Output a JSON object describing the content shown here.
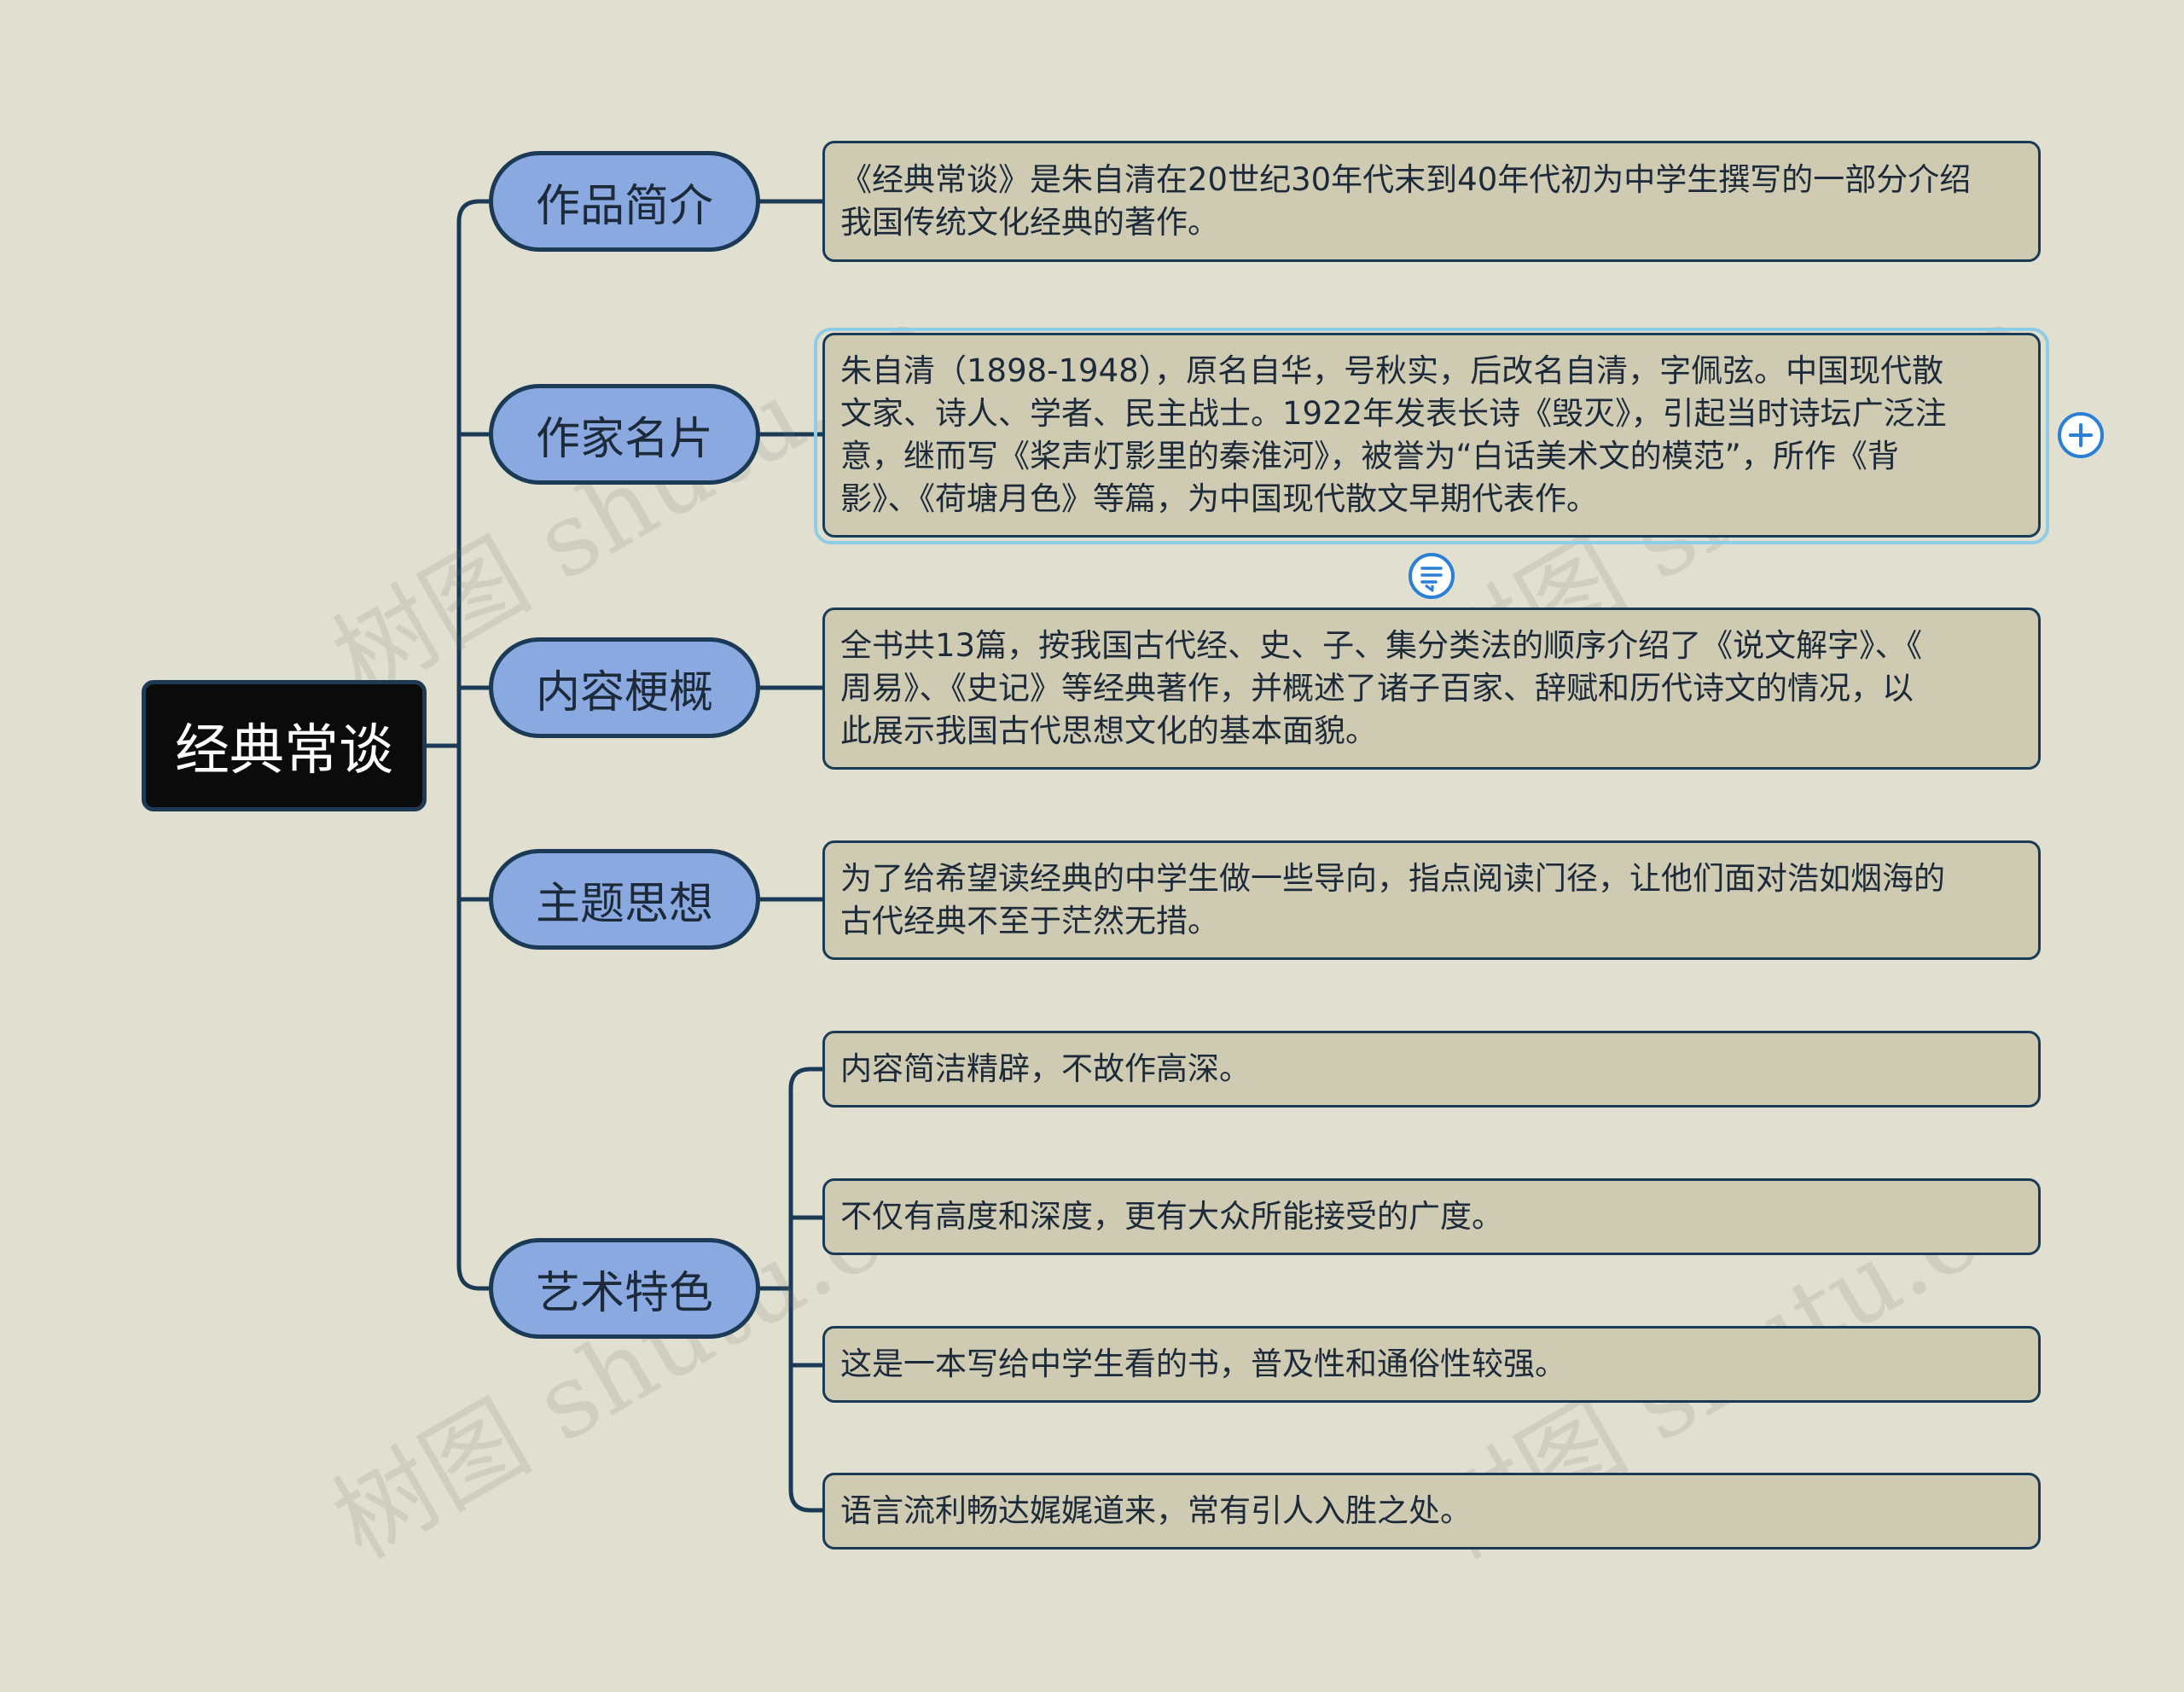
{
  "watermark_text": "树图 shutu.cn",
  "root": {
    "label": "经典常谈"
  },
  "branches": [
    {
      "label": "作品简介",
      "leaves": [
        {
          "lines": [
            "《经典常谈》是朱自清在20世纪30年代末到40年代初为中学生撰写的一部分介绍",
            "我国传统文化经典的著作。"
          ]
        }
      ]
    },
    {
      "label": "作家名片",
      "leaves": [
        {
          "lines": [
            "朱自清（1898-1948），原名自华，号秋实，后改名自清，字佩弦。中国现代散",
            "文家、诗人、学者、民主战士。1922年发表长诗《毁灭》，引起当时诗坛广泛注",
            "意，继而写《桨声灯影里的秦淮河》，被誉为“白话美术文的模范”，所作《背",
            "影》、《荷塘月色》等篇，为中国现代散文早期代表作。"
          ]
        }
      ]
    },
    {
      "label": "内容梗概",
      "leaves": [
        {
          "lines": [
            "全书共13篇，按我国古代经、史、子、集分类法的顺序介绍了《说文解字》、《",
            "周易》、《史记》等经典著作，并概述了诸子百家、辞赋和历代诗文的情况，以",
            "此展示我国古代思想文化的基本面貌。"
          ]
        }
      ]
    },
    {
      "label": "主题思想",
      "leaves": [
        {
          "lines": [
            "为了给希望读经典的中学生做一些导向，指点阅读门径，让他们面对浩如烟海的",
            "古代经典不至于茫然无措。"
          ]
        }
      ]
    },
    {
      "label": "艺术特色",
      "leaves": [
        {
          "lines": [
            "内容简洁精辟，不故作高深。"
          ]
        },
        {
          "lines": [
            "不仅有高度和深度，更有大众所能接受的广度。"
          ]
        },
        {
          "lines": [
            "这是一本写给中学生看的书，普及性和通俗性较强。"
          ]
        },
        {
          "lines": [
            "语言流利畅达娓娓道来，常有引人入胜之处。"
          ]
        }
      ]
    }
  ],
  "controls": {
    "expand_icon": "plus-circle-icon",
    "note_icon": "note-icon"
  },
  "colors": {
    "background": "#e0dfd0",
    "root_fill": "#0b0b0b",
    "branch_fill": "#8aa9e0",
    "leaf_fill": "#cfcbb2",
    "connector": "#1b3a55",
    "selection": "#8fcde6",
    "control": "#2a7fd6"
  }
}
